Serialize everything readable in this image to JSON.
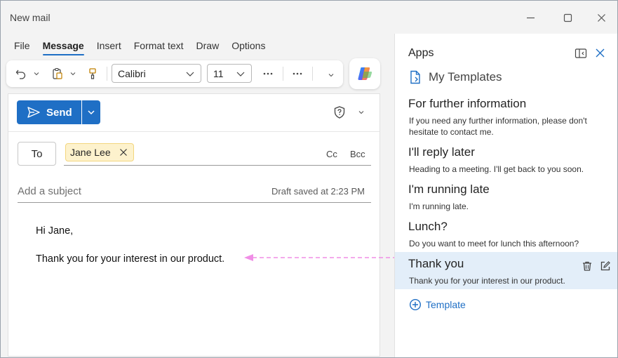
{
  "window": {
    "title": "New mail"
  },
  "menu": {
    "tabs": [
      "File",
      "Message",
      "Insert",
      "Format text",
      "Draw",
      "Options"
    ],
    "active": "Message"
  },
  "toolbar": {
    "font_name": "Calibri",
    "font_size": "11"
  },
  "compose": {
    "send_label": "Send",
    "to_label": "To",
    "recipient": "Jane Lee",
    "cc_label": "Cc",
    "bcc_label": "Bcc",
    "subject_placeholder": "Add a subject",
    "draft_status": "Draft saved at 2:23 PM",
    "body_lines": [
      "Hi Jane,",
      "Thank you for your interest in our product."
    ]
  },
  "apps_pane": {
    "title": "Apps",
    "app_name": "My Templates",
    "templates": [
      {
        "name": "For further information",
        "text": "If you need any further information, please don't hesitate to contact me."
      },
      {
        "name": "I'll reply later",
        "text": "Heading to a meeting. I'll get back to you soon."
      },
      {
        "name": "I'm running late",
        "text": "I'm running late."
      },
      {
        "name": "Lunch?",
        "text": "Do you want to meet for lunch this afternoon?"
      },
      {
        "name": "Thank you",
        "text": "Thank you for your interest in our product."
      }
    ],
    "add_template_label": "Template"
  },
  "colors": {
    "accent": "#1f6fc5",
    "selected_row": "#e3eef9",
    "recipient_pill": "#fdf2cd",
    "arrow": "#f08ee6"
  }
}
